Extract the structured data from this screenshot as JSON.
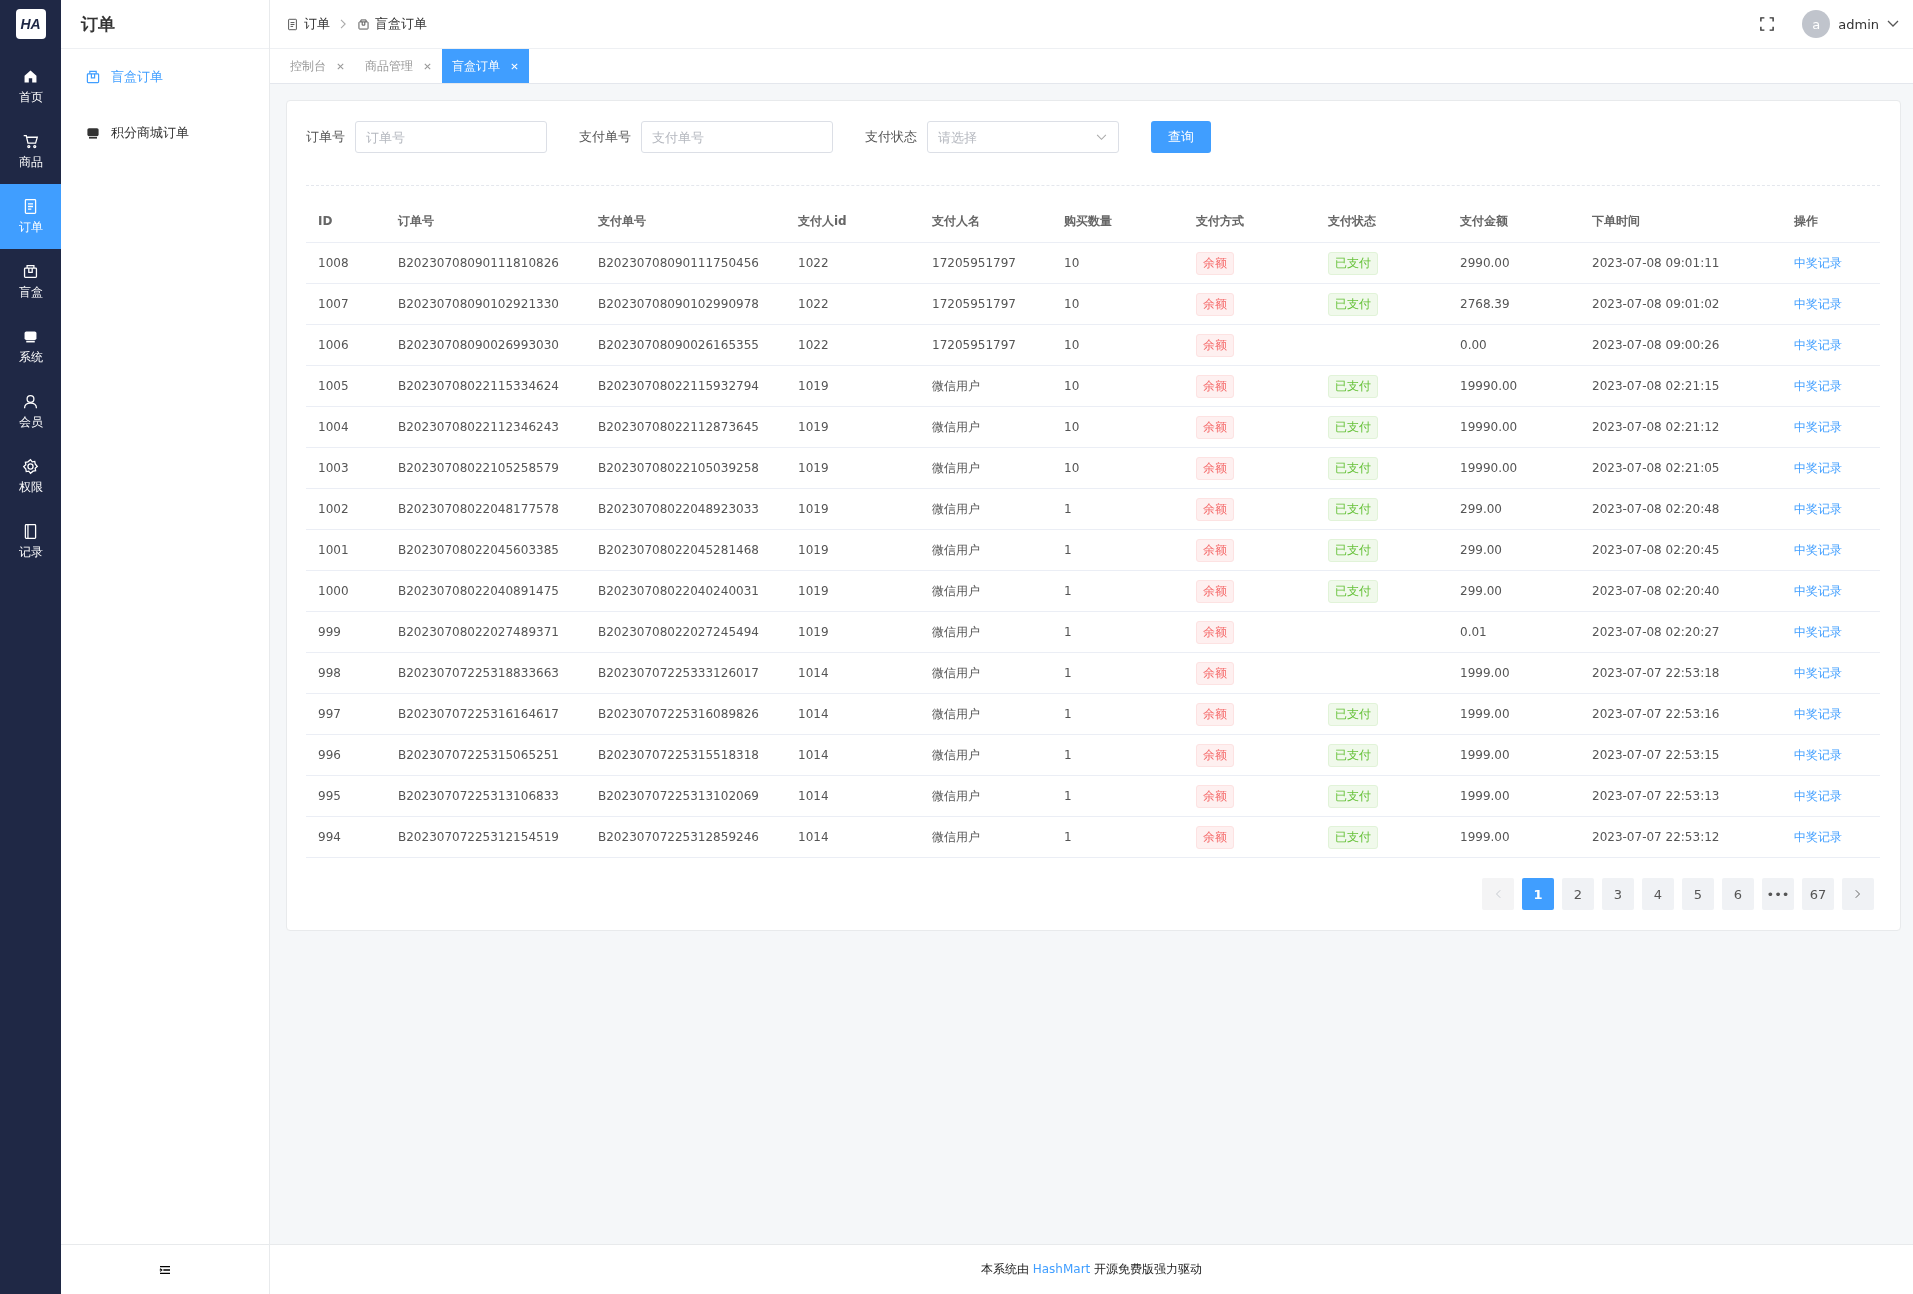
{
  "logo": "HA",
  "rail": [
    {
      "label": "首页",
      "selected": false
    },
    {
      "label": "商品",
      "selected": false
    },
    {
      "label": "订单",
      "selected": true
    },
    {
      "label": "盲盒",
      "selected": false
    },
    {
      "label": "系统",
      "selected": false
    },
    {
      "label": "会员",
      "selected": false
    },
    {
      "label": "权限",
      "selected": false
    },
    {
      "label": "记录",
      "selected": false
    }
  ],
  "sidebar": {
    "title": "订单",
    "items": [
      {
        "label": "盲盒订单",
        "selected": true
      },
      {
        "label": "积分商城订单",
        "selected": false
      }
    ]
  },
  "breadcrumb": [
    "订单",
    "盲盒订单"
  ],
  "user": {
    "avatar": "a",
    "name": "admin"
  },
  "tabs": [
    {
      "label": "控制台",
      "selected": false
    },
    {
      "label": "商品管理",
      "selected": false
    },
    {
      "label": "盲盒订单",
      "selected": true
    }
  ],
  "filters": [
    {
      "kind": "input",
      "label": "订单号",
      "placeholder": "订单号"
    },
    {
      "kind": "input",
      "label": "支付单号",
      "placeholder": "支付单号"
    },
    {
      "kind": "select",
      "label": "支付状态",
      "placeholder": "请选择"
    }
  ],
  "search_button": "查询",
  "table": {
    "columns": [
      "ID",
      "订单号",
      "支付单号",
      "支付人id",
      "支付人名",
      "购买数量",
      "支付方式",
      "支付状态",
      "支付金额",
      "下单时间",
      "操作"
    ],
    "rows": [
      {
        "id": "1008",
        "order": "B20230708090111810826",
        "pay_no": "B20230708090111750456",
        "payer_id": "1022",
        "payer": "17205951797",
        "qty": "10",
        "method": "余额",
        "status": "已支付",
        "amount": "2990.00",
        "time": "2023-07-08 09:01:11",
        "action": "中奖记录"
      },
      {
        "id": "1007",
        "order": "B20230708090102921330",
        "pay_no": "B20230708090102990978",
        "payer_id": "1022",
        "payer": "17205951797",
        "qty": "10",
        "method": "余额",
        "status": "已支付",
        "amount": "2768.39",
        "time": "2023-07-08 09:01:02",
        "action": "中奖记录"
      },
      {
        "id": "1006",
        "order": "B20230708090026993030",
        "pay_no": "B20230708090026165355",
        "payer_id": "1022",
        "payer": "17205951797",
        "qty": "10",
        "method": "余额",
        "amount": "0.00",
        "time": "2023-07-08 09:00:26",
        "action": "中奖记录"
      },
      {
        "id": "1005",
        "order": "B20230708022115334624",
        "pay_no": "B20230708022115932794",
        "payer_id": "1019",
        "payer": "微信用户",
        "qty": "10",
        "method": "余额",
        "status": "已支付",
        "amount": "19990.00",
        "time": "2023-07-08 02:21:15",
        "action": "中奖记录"
      },
      {
        "id": "1004",
        "order": "B20230708022112346243",
        "pay_no": "B20230708022112873645",
        "payer_id": "1019",
        "payer": "微信用户",
        "qty": "10",
        "method": "余额",
        "status": "已支付",
        "amount": "19990.00",
        "time": "2023-07-08 02:21:12",
        "action": "中奖记录"
      },
      {
        "id": "1003",
        "order": "B20230708022105258579",
        "pay_no": "B20230708022105039258",
        "payer_id": "1019",
        "payer": "微信用户",
        "qty": "10",
        "method": "余额",
        "status": "已支付",
        "amount": "19990.00",
        "time": "2023-07-08 02:21:05",
        "action": "中奖记录"
      },
      {
        "id": "1002",
        "order": "B20230708022048177578",
        "pay_no": "B20230708022048923033",
        "payer_id": "1019",
        "payer": "微信用户",
        "qty": "1",
        "method": "余额",
        "status": "已支付",
        "amount": "299.00",
        "time": "2023-07-08 02:20:48",
        "action": "中奖记录"
      },
      {
        "id": "1001",
        "order": "B20230708022045603385",
        "pay_no": "B20230708022045281468",
        "payer_id": "1019",
        "payer": "微信用户",
        "qty": "1",
        "method": "余额",
        "status": "已支付",
        "amount": "299.00",
        "time": "2023-07-08 02:20:45",
        "action": "中奖记录"
      },
      {
        "id": "1000",
        "order": "B20230708022040891475",
        "pay_no": "B20230708022040240031",
        "payer_id": "1019",
        "payer": "微信用户",
        "qty": "1",
        "method": "余额",
        "status": "已支付",
        "amount": "299.00",
        "time": "2023-07-08 02:20:40",
        "action": "中奖记录"
      },
      {
        "id": "999",
        "order": "B20230708022027489371",
        "pay_no": "B20230708022027245494",
        "payer_id": "1019",
        "payer": "微信用户",
        "qty": "1",
        "method": "余额",
        "amount": "0.01",
        "time": "2023-07-08 02:20:27",
        "action": "中奖记录"
      },
      {
        "id": "998",
        "order": "B20230707225318833663",
        "pay_no": "B20230707225333126017",
        "payer_id": "1014",
        "payer": "微信用户",
        "qty": "1",
        "method": "余额",
        "amount": "1999.00",
        "time": "2023-07-07 22:53:18",
        "action": "中奖记录"
      },
      {
        "id": "997",
        "order": "B20230707225316164617",
        "pay_no": "B20230707225316089826",
        "payer_id": "1014",
        "payer": "微信用户",
        "qty": "1",
        "method": "余额",
        "status": "已支付",
        "amount": "1999.00",
        "time": "2023-07-07 22:53:16",
        "action": "中奖记录"
      },
      {
        "id": "996",
        "order": "B20230707225315065251",
        "pay_no": "B20230707225315518318",
        "payer_id": "1014",
        "payer": "微信用户",
        "qty": "1",
        "method": "余额",
        "status": "已支付",
        "amount": "1999.00",
        "time": "2023-07-07 22:53:15",
        "action": "中奖记录"
      },
      {
        "id": "995",
        "order": "B20230707225313106833",
        "pay_no": "B20230707225313102069",
        "payer_id": "1014",
        "payer": "微信用户",
        "qty": "1",
        "method": "余额",
        "status": "已支付",
        "amount": "1999.00",
        "time": "2023-07-07 22:53:13",
        "action": "中奖记录"
      },
      {
        "id": "994",
        "order": "B20230707225312154519",
        "pay_no": "B20230707225312859246",
        "payer_id": "1014",
        "payer": "微信用户",
        "qty": "1",
        "method": "余额",
        "status": "已支付",
        "amount": "1999.00",
        "time": "2023-07-07 22:53:12",
        "action": "中奖记录"
      }
    ]
  },
  "pagination": [
    {
      "label": "1",
      "selected": true
    },
    {
      "label": "2",
      "selected": false
    },
    {
      "label": "3",
      "selected": false
    },
    {
      "label": "4",
      "selected": false
    },
    {
      "label": "5",
      "selected": false
    },
    {
      "label": "6",
      "selected": false
    },
    {
      "label": "•••",
      "selected": false
    },
    {
      "label": "67",
      "selected": false
    }
  ],
  "footer": {
    "before": "本系统由",
    "link": "HashMart",
    "after": "开源免费版强力驱动"
  }
}
